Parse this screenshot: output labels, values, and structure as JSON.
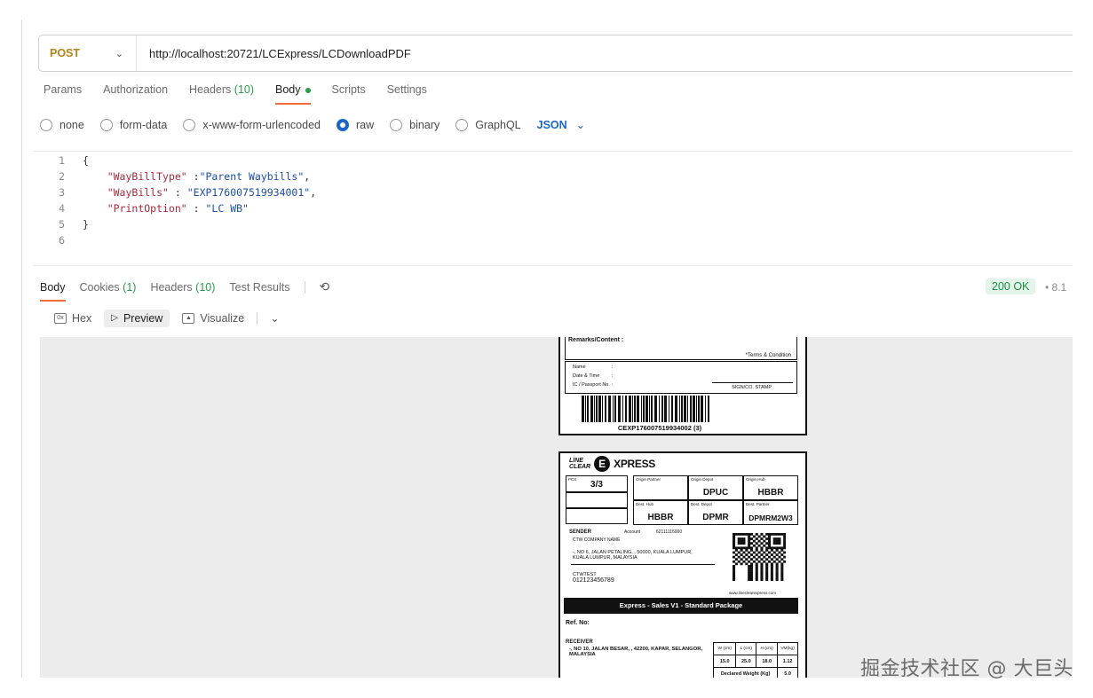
{
  "request": {
    "method": "POST",
    "url": "http://localhost:20721/LCExpress/LCDownloadPDF"
  },
  "request_tabs": [
    {
      "label": "Params"
    },
    {
      "label": "Authorization"
    },
    {
      "label": "Headers",
      "count": "(10)"
    },
    {
      "label": "Body"
    },
    {
      "label": "Scripts"
    },
    {
      "label": "Settings"
    }
  ],
  "body_types": [
    "none",
    "form-data",
    "x-www-form-urlencoded",
    "raw",
    "binary",
    "GraphQL"
  ],
  "body_format": "JSON",
  "code": {
    "line_numbers": [
      "1",
      "2",
      "3",
      "4",
      "5",
      "6"
    ],
    "open": "{",
    "close": "}",
    "pairs": [
      {
        "key": "\"WayBillType\"",
        "sep": " :",
        "value": "\"Parent Waybills\"",
        "comma": ","
      },
      {
        "key": "\"WayBills\"",
        "sep": " : ",
        "value": "\"EXP176007519934001\"",
        "comma": ","
      },
      {
        "key": "\"PrintOption\"",
        "sep": " : ",
        "value": "\"LC WB\"",
        "comma": ""
      }
    ]
  },
  "response_tabs": [
    {
      "label": "Body"
    },
    {
      "label": "Cookies",
      "count": "(1)"
    },
    {
      "label": "Headers",
      "count": "(10)"
    },
    {
      "label": "Test Results"
    }
  ],
  "status": "200 OK",
  "status_extra": "8.1",
  "view_modes": [
    "Hex",
    "Preview",
    "Visualize"
  ],
  "label_top": {
    "remarks": "Remarks/Content :",
    "terms": "*Terms & Condition",
    "name": "Name",
    "datetime": "Date & Time",
    "ic": "IC / Passport No.",
    "colon": ":",
    "sign": "SIGN/CO. STAMP",
    "barcode_text": "CEXP176007519934002 (3)"
  },
  "label_main": {
    "logo_line": "LINE",
    "logo_clear": "CLEAR",
    "logo_e": "E",
    "logo_xpress": "XPRESS",
    "pcs_label": "PCS",
    "pcs_value": "3/3",
    "origin_partner_label": "Origin Partner",
    "origin_depot_label": "Origin Depot",
    "origin_depot": "DPUC",
    "origin_hub_label": "Origin Hub",
    "origin_hub": "HBBR",
    "dest_hub_label": "Dest. Hub",
    "dest_hub": "HBBR",
    "dest_depot_label": "Dest. Depot",
    "dest_depot": "DPMR",
    "dest_partner_label": "Dest. Partner",
    "dest_partner": "DPMRM2W3",
    "sender_label": "SENDER",
    "account_label": "Account",
    "account": "62111116000",
    "company": "CTW COMPANY NAME",
    "sender_address": "-, NO 6, JALAN PETALING, , 50000, KUALA LUMPUR, KUALA LUMPUR, MALAYSIA",
    "sender_contact": "CTWTEST",
    "sender_phone": "012123456789",
    "website": "www.lineclearexpress.com",
    "service": "Express - Sales V1 - Standard Package",
    "ref": "Ref. No:",
    "receiver_label": "RECEIVER",
    "receiver_address": "-, NO 10, JALAN BESAR, , 42200, KAPAR, SELANGOR, MALAYSIA",
    "dim_headers": [
      "W (cm)",
      "L (cm)",
      "H (cm)",
      "VM(kg)"
    ],
    "dim_values": [
      "15.0",
      "25.0",
      "18.0",
      "1.12"
    ],
    "declared_label": "Declared Weight (Kg)",
    "declared_value": "5.0"
  },
  "watermark": "掘金技术社区 @ 大巨头"
}
